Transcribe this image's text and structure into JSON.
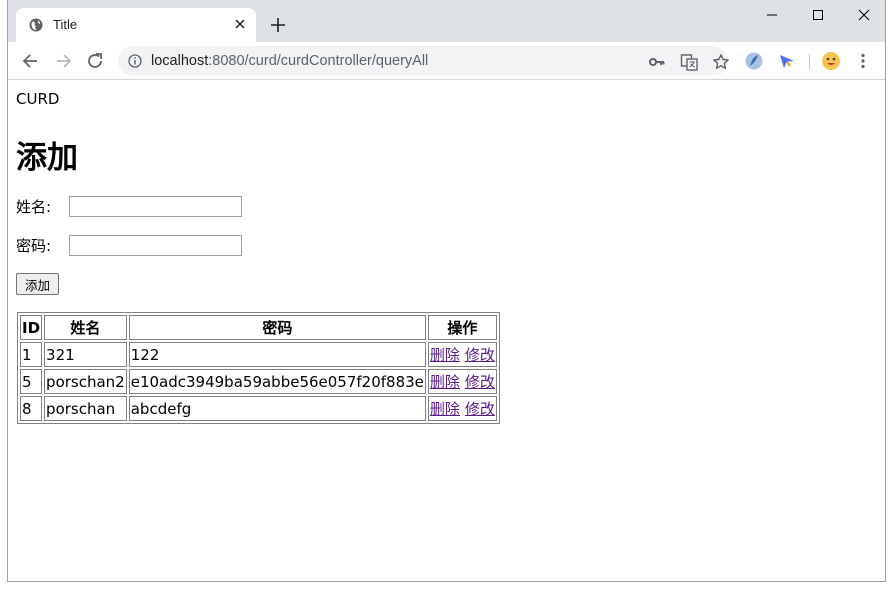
{
  "browser": {
    "tab_title": "Title",
    "url_host": "localhost",
    "url_rest": ":8080/curd/curdController/queryAll"
  },
  "page": {
    "brand": "CURD",
    "heading": "添加",
    "form": {
      "name_label": "姓名:",
      "password_label": "密码:",
      "name_value": "",
      "password_value": "",
      "submit_label": "添加"
    },
    "table": {
      "headers": [
        "ID",
        "姓名",
        "密码",
        "操作"
      ],
      "rows": [
        {
          "id": "1",
          "name": "321",
          "password": "122",
          "delete": "删除",
          "edit": "修改"
        },
        {
          "id": "5",
          "name": "porschan2",
          "password": "e10adc3949ba59abbe56e057f20f883e",
          "delete": "删除",
          "edit": "修改"
        },
        {
          "id": "8",
          "name": "porschan",
          "password": "abcdefg",
          "delete": "删除",
          "edit": "修改"
        }
      ]
    }
  },
  "colors": {
    "link_visited": "#551a8b",
    "chrome_titlebar": "#dee1e6"
  }
}
